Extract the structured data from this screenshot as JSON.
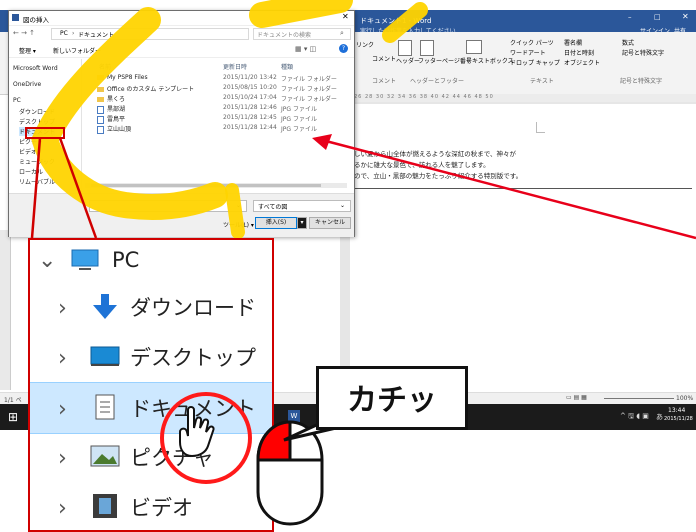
{
  "word": {
    "title": "ドキュメント1 - Word",
    "search_hint": "実行したい作業を入力してください...",
    "signin": "サインイン",
    "share": "共有",
    "ribbon": {
      "link": "リンク",
      "comment": "コメント",
      "header": "ヘッダー",
      "footer": "フッター",
      "page_number": "ページ番号",
      "text_box": "テキストボックス",
      "quick_parts": "クイック パーツ",
      "wordart": "ワードアート",
      "dropcap": "ドロップ キャップ",
      "signature": "署名欄",
      "datetime": "日付と時刻",
      "object": "オブジェクト",
      "equation": "数式",
      "symbol": "記号と特殊文字",
      "group_comment": "コメント",
      "group_header_footer": "ヘッダーとフッター",
      "group_text": "テキスト",
      "group_symbols": "記号と特殊文字"
    },
    "ruler": "26 28 30 32 34 36 38 40 42 44 46 48 50",
    "doc_lines": [
      "しい夏から山全体が燃えるような深紅の秋まで、神々が",
      "るかに雄大な景色で、訪れる人を魅了します。",
      "ので、立山・黒部の魅力をたっぷり紹介する特別版です。"
    ],
    "status_left": "1/1 ペ",
    "zoom": "100%",
    "clock_time": "13:44",
    "clock_date": "2015/11/28",
    "ime": "あ"
  },
  "dialog": {
    "title": "図の挿入",
    "path": [
      "PC",
      "ドキュメント"
    ],
    "search_placeholder": "ドキュメントの検索",
    "organize": "整理 ▾",
    "new_folder": "新しいフォルダー",
    "columns": [
      "名前",
      "更新日時",
      "種類"
    ],
    "files": [
      {
        "name": "My PSP8 Files",
        "date": "2015/11/20 13:42",
        "type": "ファイル フォルダー",
        "kind": "folder"
      },
      {
        "name": "Office のカスタム テンプレート",
        "date": "2015/08/15 10:20",
        "type": "ファイル フォルダー",
        "kind": "folder"
      },
      {
        "name": "黒くろ",
        "date": "2015/10/24 17:04",
        "type": "ファイル フォルダー",
        "kind": "folder"
      },
      {
        "name": "黒部湖",
        "date": "2015/11/28 12:46",
        "type": "JPG ファイル",
        "kind": "jpg"
      },
      {
        "name": "雷鳥平",
        "date": "2015/11/28 12:45",
        "type": "JPG ファイル",
        "kind": "jpg"
      },
      {
        "name": "立山山頂",
        "date": "2015/11/28 12:44",
        "type": "JPG ファイル",
        "kind": "jpg"
      }
    ],
    "nav": [
      "Microsoft Word",
      "OneDrive",
      "PC",
      "ダウンロード",
      "デスクトップ",
      "ドキュメント",
      "ピクチャ",
      "ビデオ",
      "ミュージック",
      "ローカル",
      "リムーバブル"
    ],
    "filter": "すべての図",
    "tools": "ツール(L) ▾",
    "insert": "挿入(S)",
    "cancel": "キャンセル"
  },
  "zoom_panel": {
    "pc": "PC",
    "items": [
      "ダウンロード",
      "デスクトップ",
      "ドキュメント",
      "ピクチャ",
      "ビデオ"
    ]
  },
  "callout": "カチッ",
  "colors": {
    "accent": "#2b579a",
    "highlight_stroke": "#ff1a1a",
    "arrow": "#e8001a",
    "yellow": "#ffd400"
  }
}
